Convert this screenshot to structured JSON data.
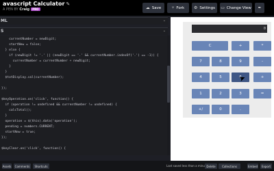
{
  "header": {
    "title": "avascript Calculator",
    "byline_prefix": "A PEN BY",
    "author": "Craig",
    "badge": "PRO",
    "buttons": [
      {
        "label": "Save"
      },
      {
        "label": "Fork"
      },
      {
        "label": "Settings"
      },
      {
        "label": "Change View"
      }
    ]
  },
  "editors": {
    "html_label": "ML",
    "js_label": "S"
  },
  "code_lines": [
    "    currentNumber = newDigit;",
    "    startNew = false;",
    "  } else {",
    "    if (newDigit != '.' || (newDigit == '.' && currentNumber.indexOf('.') == -1)) {",
    "      currentNumber = currentNumber + newDigit;",
    "    }",
    "  }",
    "  $totDisplay.val(currentNumber);",
    "",
    "});",
    "",
    "$keyOperation.on('click', function() {",
    "  if (operation != undefined && currentNumber != undefined) {",
    "    calcTotal();",
    "  }",
    "  operation = $(this).data('operation');",
    "  pending = numbers.CURRENT;",
    "  startNew = true;",
    "});",
    "",
    "$keyClear.on('click', function() {"
  ],
  "calculator": {
    "display_value": "0",
    "rows": [
      [
        "C",
        "+",
        "*"
      ],
      [
        "7",
        "8",
        "9",
        "-"
      ],
      [
        "4",
        "5",
        "6",
        "+"
      ],
      [
        "1",
        "2",
        "3",
        "="
      ],
      [
        "+/",
        "0",
        "."
      ]
    ]
  },
  "footer": {
    "left_buttons": [
      "Assets",
      "Comments",
      "Shortcuts"
    ],
    "status": "Last saved less than a minute ago",
    "right_buttons": [
      "Delete",
      "Collections",
      "Embed",
      "Export"
    ]
  },
  "colors": {
    "key": "#6985b7",
    "key_hover": "#3f5785",
    "display_bg": "#2a2b2f",
    "topbar_bg": "#000000",
    "editor_bg": "#1d1e22"
  }
}
